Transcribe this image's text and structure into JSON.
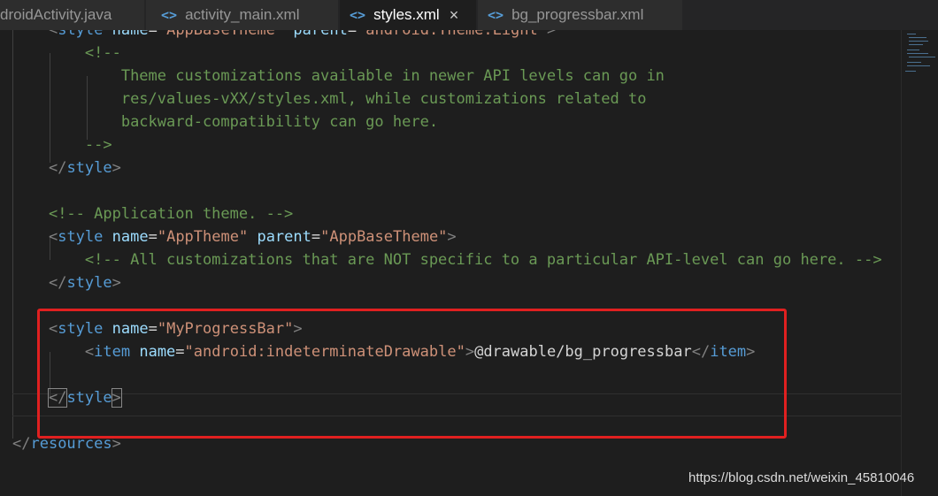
{
  "tabs": [
    {
      "label": "droidActivity.java",
      "icon": "java-file-icon"
    },
    {
      "label": "activity_main.xml",
      "icon": "xml-file-icon"
    },
    {
      "label": "styles.xml",
      "icon": "xml-file-icon",
      "active": true,
      "close": "×"
    },
    {
      "label": "bg_progressbar.xml",
      "icon": "xml-file-icon"
    }
  ],
  "tab_icon_glyph": "<>",
  "code": {
    "l0": {
      "open": "<",
      "tag": "style",
      "a1": "name",
      "v1": "\"AppBaseTheme\"",
      "a2": "parent",
      "v2": "\"android:Theme.Light\"",
      "close": ">"
    },
    "l1": "<!--",
    "l2": "Theme customizations available in newer API levels can go in",
    "l3": "res/values-vXX/styles.xml, while customizations related to",
    "l4": "backward-compatibility can go here.",
    "l5": "-->",
    "l6": {
      "open": "</",
      "tag": "style",
      "close": ">"
    },
    "l8": "<!-- Application theme. -->",
    "l9": {
      "open": "<",
      "tag": "style",
      "a1": "name",
      "v1": "\"AppTheme\"",
      "a2": "parent",
      "v2": "\"AppBaseTheme\"",
      "close": ">"
    },
    "l10": "<!-- All customizations that are NOT specific to a particular API-level can go here. -->",
    "l11": {
      "open": "</",
      "tag": "style",
      "close": ">"
    },
    "l13": {
      "open": "<",
      "tag": "style",
      "a1": "name",
      "v1": "\"MyProgressBar\"",
      "close": ">"
    },
    "l14": {
      "open": "<",
      "tag": "item",
      "a1": "name",
      "v1": "\"android:indeterminateDrawable\"",
      "close": ">",
      "text": "@drawable/bg_progressbar",
      "end_open": "</",
      "end_tag": "item",
      "end_close": ">"
    },
    "l16": {
      "open": "</",
      "tag": "style",
      "close": ">"
    },
    "l18": {
      "open": "</",
      "tag": "resources",
      "close": ">"
    }
  },
  "eq": "=",
  "watermark": "https://blog.csdn.net/weixin_45810046",
  "colors": {
    "tag": "#569cd6",
    "attribute": "#9cdcfe",
    "value": "#ce9178",
    "comment": "#6a9955",
    "highlight_box": "#e02020"
  }
}
